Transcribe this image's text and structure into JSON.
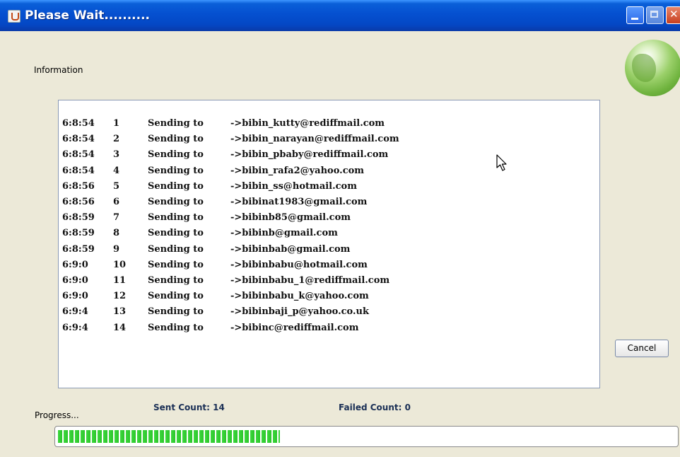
{
  "window": {
    "title": "Please Wait.........."
  },
  "info_label": "Information",
  "log": [
    {
      "time": "6:8:54",
      "num": "1",
      "msg": "Sending to",
      "email": "->bibin_kutty@rediffmail.com"
    },
    {
      "time": "6:8:54",
      "num": "2",
      "msg": "Sending to",
      "email": "->bibin_narayan@rediffmail.com"
    },
    {
      "time": "6:8:54",
      "num": "3",
      "msg": "Sending to",
      "email": "->bibin_pbaby@rediffmail.com"
    },
    {
      "time": "6:8:54",
      "num": "4",
      "msg": "Sending to",
      "email": "->bibin_rafa2@yahoo.com"
    },
    {
      "time": "6:8:56",
      "num": "5",
      "msg": "Sending to",
      "email": "->bibin_ss@hotmail.com"
    },
    {
      "time": "6:8:56",
      "num": "6",
      "msg": "Sending to",
      "email": "->bibinat1983@gmail.com"
    },
    {
      "time": "6:8:59",
      "num": "7",
      "msg": "Sending to",
      "email": "->bibinb85@gmail.com"
    },
    {
      "time": "6:8:59",
      "num": "8",
      "msg": "Sending to",
      "email": "->bibinb@gmail.com"
    },
    {
      "time": "6:8:59",
      "num": "9",
      "msg": "Sending to",
      "email": "->bibinbab@gmail.com"
    },
    {
      "time": "6:9:0",
      "num": "10",
      "msg": "Sending to",
      "email": "->bibinbabu@hotmail.com"
    },
    {
      "time": "6:9:0",
      "num": "11",
      "msg": "Sending to",
      "email": "->bibinbabu_1@rediffmail.com"
    },
    {
      "time": "6:9:0",
      "num": "12",
      "msg": "Sending to",
      "email": "->bibinbabu_k@yahoo.com"
    },
    {
      "time": "6:9:4",
      "num": "13",
      "msg": "Sending to",
      "email": "->bibinbaji_p@yahoo.co.uk"
    },
    {
      "time": "6:9:4",
      "num": "14",
      "msg": "Sending to",
      "email": "->bibinc@rediffmail.com"
    }
  ],
  "cancel_label": "Cancel",
  "stats": {
    "sent": "Sent Count:  14",
    "failed": "Failed Count:  0"
  },
  "progress": {
    "label": "Progress...",
    "fraction": 0.36
  },
  "icons": {
    "app": "java-app-icon",
    "minimize": "minimize-icon",
    "maximize": "maximize-icon",
    "close": "close-icon",
    "globe": "globe-icon",
    "cursor": "mouse-pointer-icon"
  },
  "colors": {
    "titlebar": "#0550d0",
    "progress": "#2bc52b",
    "window_bg": "#ece9d8"
  }
}
